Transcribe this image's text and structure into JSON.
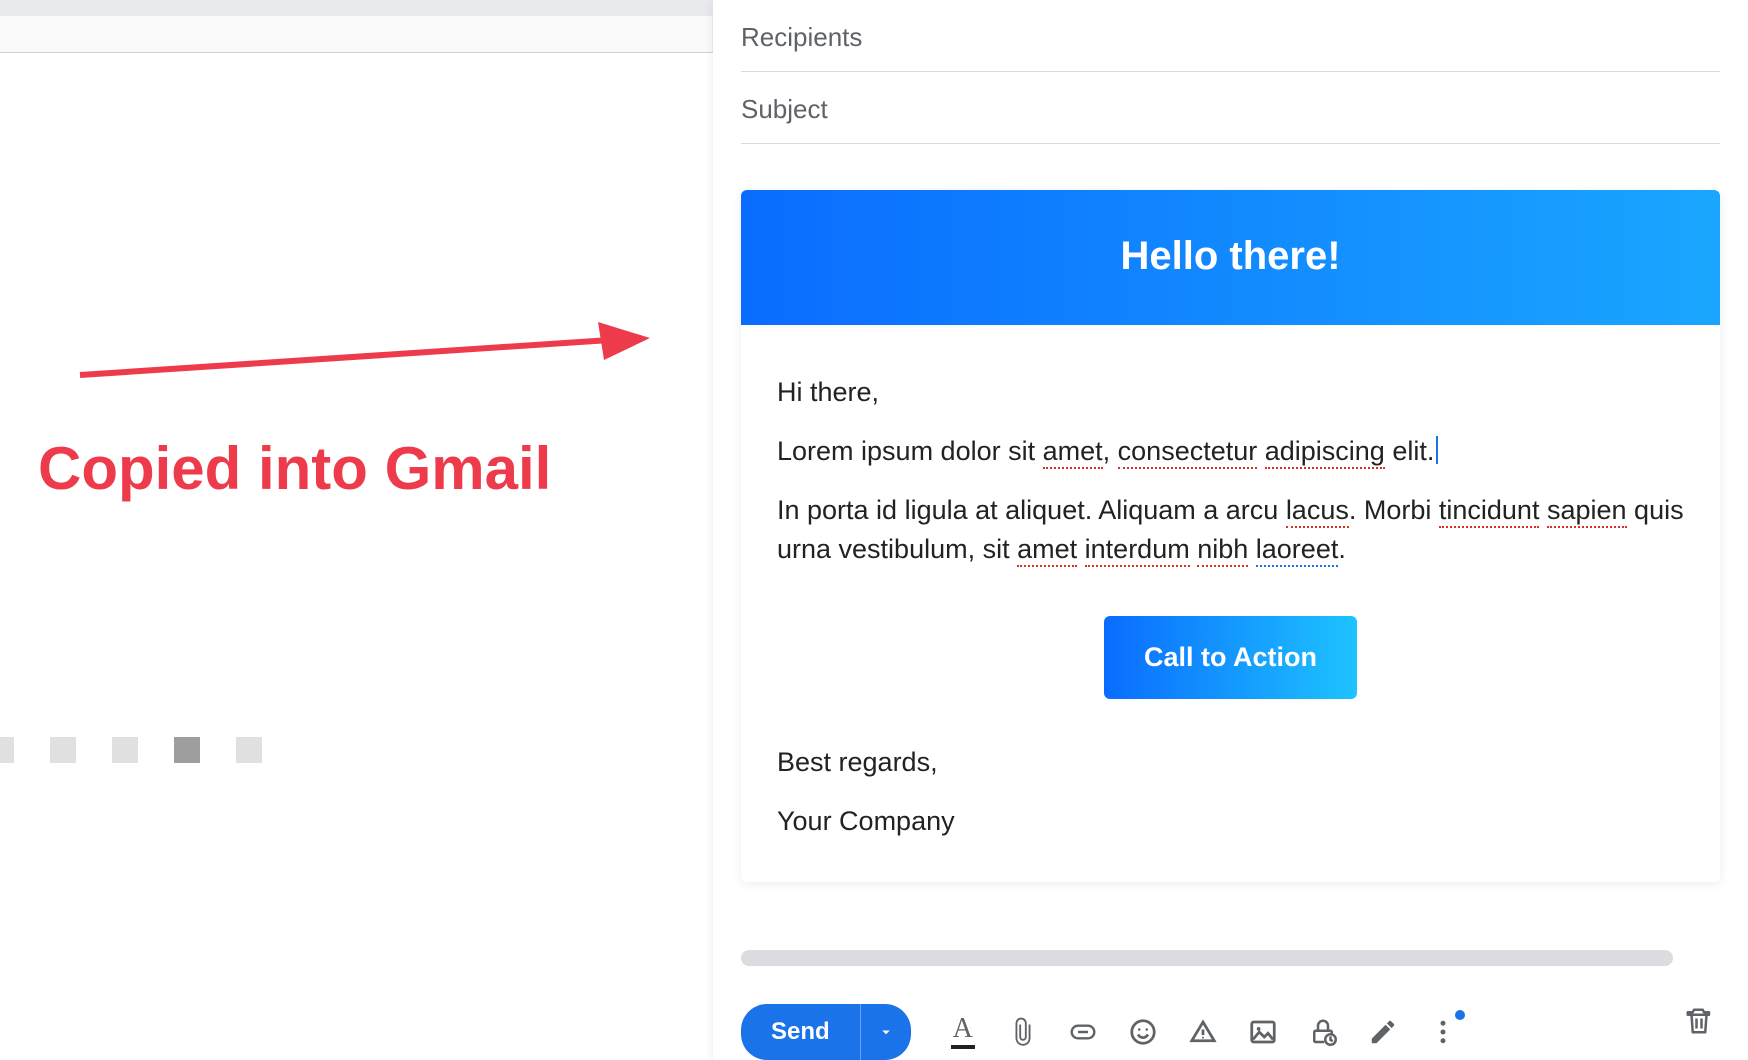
{
  "annotation": {
    "label": "Copied into Gmail"
  },
  "compose": {
    "recipients_placeholder": "Recipients",
    "subject_placeholder": "Subject",
    "send_label": "Send"
  },
  "email": {
    "header": "Hello there!",
    "greeting": "Hi there,",
    "para1_a": "Lorem ipsum dolor sit ",
    "para1_b": "amet",
    "para1_c": ", ",
    "para1_d": "consectetur",
    "para1_e": " ",
    "para1_f": "adipiscing",
    "para1_g": " elit.",
    "para2_a": "In porta id ligula at aliquet. Aliquam a arcu ",
    "para2_b": "lacus",
    "para2_c": ". Morbi ",
    "para2_d": "tincidunt",
    "para2_e": " ",
    "para2_f": "sapien",
    "para2_g": " quis urna vestibulum, sit ",
    "para2_h": "amet",
    "para2_i": " ",
    "para2_j": "interdum",
    "para2_k": " ",
    "para2_l": "nibh",
    "para2_m": " ",
    "para2_n": "laoreet",
    "para2_o": ".",
    "cta": "Call to Action",
    "signoff1": "Best regards,",
    "signoff2": "Your Company"
  }
}
